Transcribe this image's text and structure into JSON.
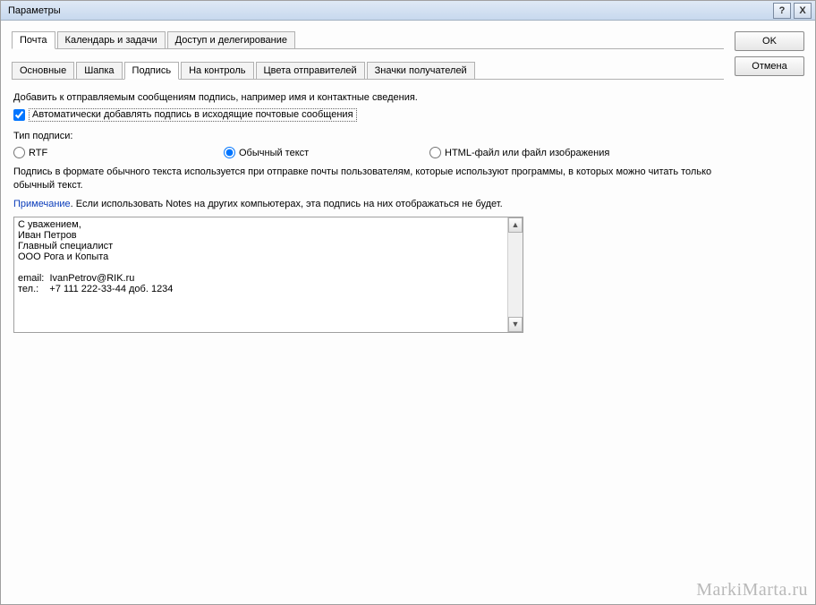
{
  "window": {
    "title": "Параметры"
  },
  "buttons": {
    "ok": "OK",
    "cancel": "Отмена",
    "help": "?",
    "close": "X"
  },
  "tabs_main": {
    "mail": "Почта",
    "calendar": "Календарь и задачи",
    "access": "Доступ и делегирование"
  },
  "tabs_sub": {
    "basic": "Основные",
    "header": "Шапка",
    "signature": "Подпись",
    "control": "На контроль",
    "colors": "Цвета отправителей",
    "icons": "Значки получателей"
  },
  "signature_pane": {
    "intro": "Добавить к отправляемым сообщениям подпись, например имя и контактные сведения.",
    "auto_checkbox": "Автоматически добавлять подпись в исходящие почтовые сообщения",
    "type_label": "Тип подписи:",
    "radio_rtf": "RTF",
    "radio_plain": "Обычный текст",
    "radio_html": "HTML-файл или файл изображения",
    "desc1": "Подпись в формате обычного текста используется при отправке почты пользователям, которые используют программы, в которых можно читать только обычный текст.",
    "note_label": "Примечание",
    "note_text": ". Если использовать Notes на других компьютерах, эта подпись на них отображаться не будет.",
    "signature_text": "С уважением,\nИван Петров\nГлавный специалист\nООО Рога и Копыта\n\nemail:  IvanPetrov@RIK.ru\nтел.:    +7 111 222-33-44 доб. 1234"
  },
  "watermark": "MarkiMarta.ru"
}
